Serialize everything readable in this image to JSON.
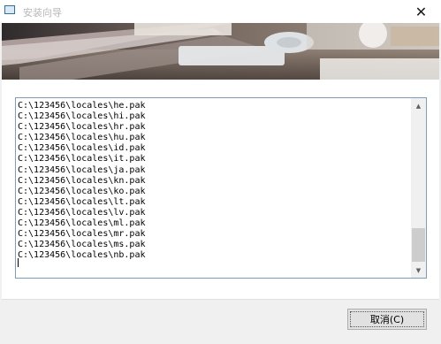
{
  "window": {
    "title": "安装向导",
    "close_glyph": "✕"
  },
  "log": {
    "lines": [
      "C:\\123456\\locales\\he.pak",
      "C:\\123456\\locales\\hi.pak",
      "C:\\123456\\locales\\hr.pak",
      "C:\\123456\\locales\\hu.pak",
      "C:\\123456\\locales\\id.pak",
      "C:\\123456\\locales\\it.pak",
      "C:\\123456\\locales\\ja.pak",
      "C:\\123456\\locales\\kn.pak",
      "C:\\123456\\locales\\ko.pak",
      "C:\\123456\\locales\\lt.pak",
      "C:\\123456\\locales\\lv.pak",
      "C:\\123456\\locales\\ml.pak",
      "C:\\123456\\locales\\mr.pak",
      "C:\\123456\\locales\\ms.pak",
      "C:\\123456\\locales\\nb.pak"
    ],
    "scroll_up_glyph": "▲",
    "scroll_down_glyph": "▼"
  },
  "footer": {
    "cancel_label": "取消(C)"
  }
}
